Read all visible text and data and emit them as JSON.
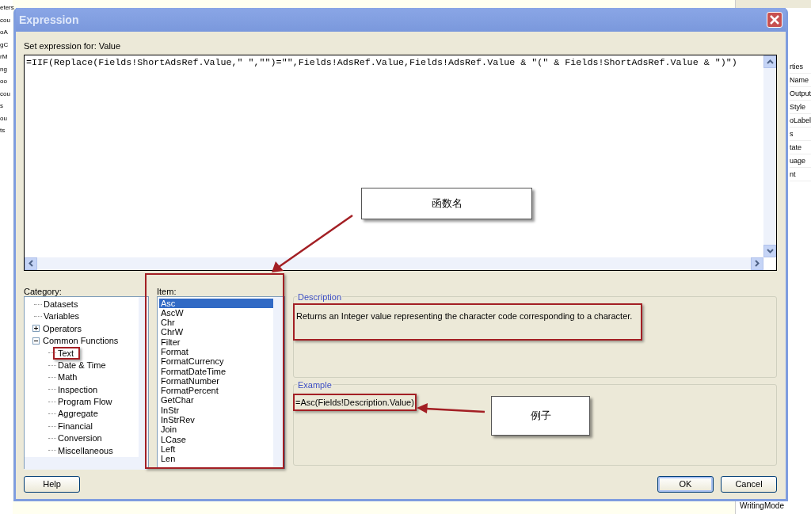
{
  "background": {
    "left_panel_items": [
      "eters",
      "cou",
      "oA",
      "gC",
      "rM",
      "ng",
      "oo",
      "cou",
      "s",
      "ou",
      "ts"
    ],
    "right_panel_items": [
      "rties",
      "Name",
      "Output",
      "Style",
      "oLabel",
      "s",
      "tate",
      "uage",
      "nt"
    ],
    "bottom_right_item": "WritingMode"
  },
  "dialog": {
    "title": "Expression",
    "expression_label": "Set expression for: Value",
    "expression": "=IIF(Replace(Fields!ShortAdsRef.Value,\" \",\"\")=\"\",Fields!AdsRef.Value,Fields!AdsRef.Value & \"(\" & Fields!ShortAdsRef.Value & \")\")",
    "category_label": "Category:",
    "categories": [
      {
        "label": "Datasets",
        "kind": "leaf",
        "highlighted": false
      },
      {
        "label": "Variables",
        "kind": "leaf",
        "highlighted": false
      },
      {
        "label": "Operators",
        "kind": "group",
        "expanded": false,
        "highlighted": false
      },
      {
        "label": "Common Functions",
        "kind": "group",
        "expanded": true,
        "highlighted": false,
        "children": [
          {
            "label": "Text",
            "kind": "leaf",
            "highlighted": true
          },
          {
            "label": "Date & Time",
            "kind": "leaf",
            "highlighted": false
          },
          {
            "label": "Math",
            "kind": "leaf",
            "highlighted": false
          },
          {
            "label": "Inspection",
            "kind": "leaf",
            "highlighted": false
          },
          {
            "label": "Program Flow",
            "kind": "leaf",
            "highlighted": false
          },
          {
            "label": "Aggregate",
            "kind": "leaf",
            "highlighted": false
          },
          {
            "label": "Financial",
            "kind": "leaf",
            "highlighted": false
          },
          {
            "label": "Conversion",
            "kind": "leaf",
            "highlighted": false
          },
          {
            "label": "Miscellaneous",
            "kind": "leaf",
            "highlighted": false
          }
        ]
      }
    ],
    "item_label": "Item:",
    "items": [
      {
        "label": "Asc",
        "selected": true
      },
      {
        "label": "AscW",
        "selected": false
      },
      {
        "label": "Chr",
        "selected": false
      },
      {
        "label": "ChrW",
        "selected": false
      },
      {
        "label": "Filter",
        "selected": false
      },
      {
        "label": "Format",
        "selected": false
      },
      {
        "label": "FormatCurrency",
        "selected": false
      },
      {
        "label": "FormatDateTime",
        "selected": false
      },
      {
        "label": "FormatNumber",
        "selected": false
      },
      {
        "label": "FormatPercent",
        "selected": false
      },
      {
        "label": "GetChar",
        "selected": false
      },
      {
        "label": "InStr",
        "selected": false
      },
      {
        "label": "InStrRev",
        "selected": false
      },
      {
        "label": "Join",
        "selected": false
      },
      {
        "label": "LCase",
        "selected": false
      },
      {
        "label": "Left",
        "selected": false
      },
      {
        "label": "Len",
        "selected": false
      }
    ],
    "description": {
      "legend": "Description",
      "text": "Returns an Integer value representing the character code corresponding to a character.",
      "highlighted": true
    },
    "example": {
      "legend": "Example",
      "text": "=Asc(Fields!Description.Value)",
      "highlighted": true
    },
    "buttons": [
      {
        "label": "Help",
        "default": false
      },
      {
        "label": "OK",
        "default": true
      },
      {
        "label": "Cancel",
        "default": false
      }
    ]
  },
  "annotations": [
    {
      "text": "函数名"
    },
    {
      "text": "例子"
    }
  ]
}
